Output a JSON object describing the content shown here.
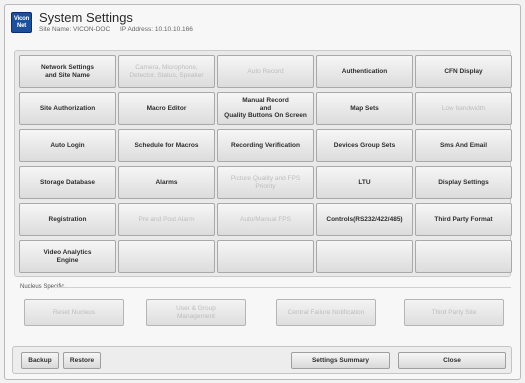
{
  "header": {
    "logo_text": "Vicon\nNet",
    "title": "System Settings",
    "site_name": "Site Name: VICON-DOC",
    "ip_address": "IP Address: 10.10.10.166"
  },
  "grid": [
    {
      "label": "Network Settings\nand Site Name",
      "enabled": true
    },
    {
      "label": "Camera, Microphone,\nDetector, Status, Speaker",
      "enabled": false
    },
    {
      "label": "Auto Record",
      "enabled": false
    },
    {
      "label": "Authentication",
      "enabled": true
    },
    {
      "label": "CFN Display",
      "enabled": true
    },
    {
      "label": "Site Authorization",
      "enabled": true
    },
    {
      "label": "Macro Editor",
      "enabled": true
    },
    {
      "label": "Manual Record\nand\nQuality Buttons On Screen",
      "enabled": true
    },
    {
      "label": "Map Sets",
      "enabled": true
    },
    {
      "label": "Low bandwidth",
      "enabled": false
    },
    {
      "label": "Auto Login",
      "enabled": true
    },
    {
      "label": "Schedule for Macros",
      "enabled": true
    },
    {
      "label": "Recording Verification",
      "enabled": true
    },
    {
      "label": "Devices Group Sets",
      "enabled": true
    },
    {
      "label": "Sms And Email",
      "enabled": true
    },
    {
      "label": "Storage Database",
      "enabled": true
    },
    {
      "label": "Alarms",
      "enabled": true
    },
    {
      "label": "Picture Quality and FPS\nPriority",
      "enabled": false
    },
    {
      "label": "LTU",
      "enabled": true
    },
    {
      "label": "Display Settings",
      "enabled": true
    },
    {
      "label": "Registration",
      "enabled": true
    },
    {
      "label": "Pre and Post Alarm",
      "enabled": false
    },
    {
      "label": "Auto/Manual FPS",
      "enabled": false
    },
    {
      "label": "Controls(RS232/422/485)",
      "enabled": true
    },
    {
      "label": "Third Party Format",
      "enabled": true
    },
    {
      "label": "Video Analytics\nEngine",
      "enabled": true
    },
    {
      "label": "",
      "enabled": false
    },
    {
      "label": "",
      "enabled": false
    },
    {
      "label": "",
      "enabled": false
    },
    {
      "label": "",
      "enabled": false
    }
  ],
  "nucleus": {
    "section_label": "Nucleus Specific",
    "buttons": [
      {
        "label": "Reset Nucleus"
      },
      {
        "label": "User & Group\nManagement"
      },
      {
        "label": "Central Failure Notification"
      },
      {
        "label": "Third Party Site"
      }
    ]
  },
  "footer": {
    "backup_label": "Backup",
    "restore_label": "Restore",
    "summary_label": "Settings Summary",
    "close_label": "Close"
  }
}
